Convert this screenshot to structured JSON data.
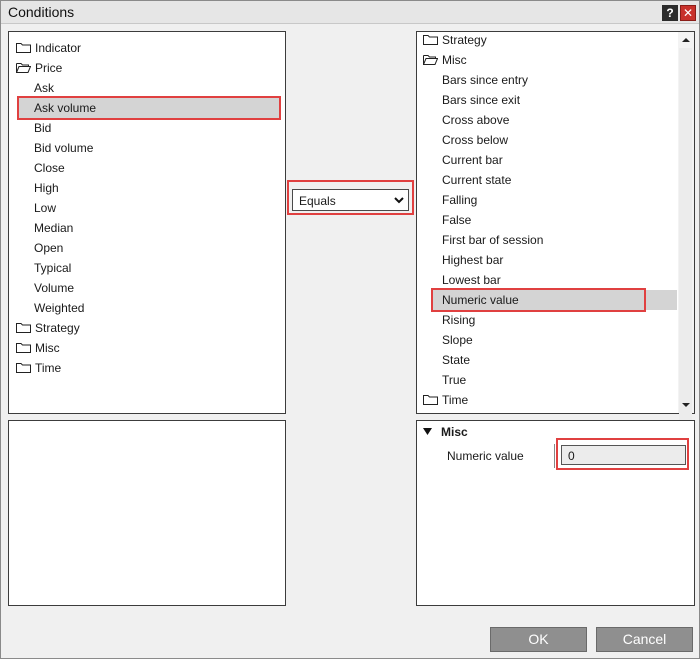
{
  "window": {
    "title": "Conditions",
    "help_label": "?",
    "close_label": "✕"
  },
  "left_tree": {
    "items": [
      {
        "label": "Indicator",
        "type": "folder"
      },
      {
        "label": "Price",
        "type": "folder-open"
      },
      {
        "label": "Ask",
        "type": "item"
      },
      {
        "label": "Ask volume",
        "type": "item",
        "selected": true
      },
      {
        "label": "Bid",
        "type": "item"
      },
      {
        "label": "Bid volume",
        "type": "item"
      },
      {
        "label": "Close",
        "type": "item"
      },
      {
        "label": "High",
        "type": "item"
      },
      {
        "label": "Low",
        "type": "item"
      },
      {
        "label": "Median",
        "type": "item"
      },
      {
        "label": "Open",
        "type": "item"
      },
      {
        "label": "Typical",
        "type": "item"
      },
      {
        "label": "Volume",
        "type": "item"
      },
      {
        "label": "Weighted",
        "type": "item"
      },
      {
        "label": "Strategy",
        "type": "folder"
      },
      {
        "label": "Misc",
        "type": "folder"
      },
      {
        "label": "Time",
        "type": "folder"
      }
    ]
  },
  "operator": {
    "selected": "Equals"
  },
  "right_tree": {
    "items": [
      {
        "label": "Strategy",
        "type": "folder"
      },
      {
        "label": "Misc",
        "type": "folder-open"
      },
      {
        "label": "Bars since entry",
        "type": "item"
      },
      {
        "label": "Bars since exit",
        "type": "item"
      },
      {
        "label": "Cross above",
        "type": "item"
      },
      {
        "label": "Cross below",
        "type": "item"
      },
      {
        "label": "Current bar",
        "type": "item"
      },
      {
        "label": "Current state",
        "type": "item"
      },
      {
        "label": "Falling",
        "type": "item"
      },
      {
        "label": "False",
        "type": "item"
      },
      {
        "label": "First bar of session",
        "type": "item"
      },
      {
        "label": "Highest bar",
        "type": "item"
      },
      {
        "label": "Lowest bar",
        "type": "item"
      },
      {
        "label": "Numeric value",
        "type": "item",
        "selected": true
      },
      {
        "label": "Rising",
        "type": "item"
      },
      {
        "label": "Slope",
        "type": "item"
      },
      {
        "label": "State",
        "type": "item"
      },
      {
        "label": "True",
        "type": "item"
      },
      {
        "label": "Time",
        "type": "folder"
      }
    ]
  },
  "properties": {
    "group_label": "Misc",
    "field_label": "Numeric value",
    "field_value": "0"
  },
  "buttons": {
    "ok": "OK",
    "cancel": "Cancel"
  },
  "colors": {
    "highlight_border": "#e04040",
    "selection_bg": "#d4d4d4",
    "button_bg": "#8f8f8f"
  }
}
